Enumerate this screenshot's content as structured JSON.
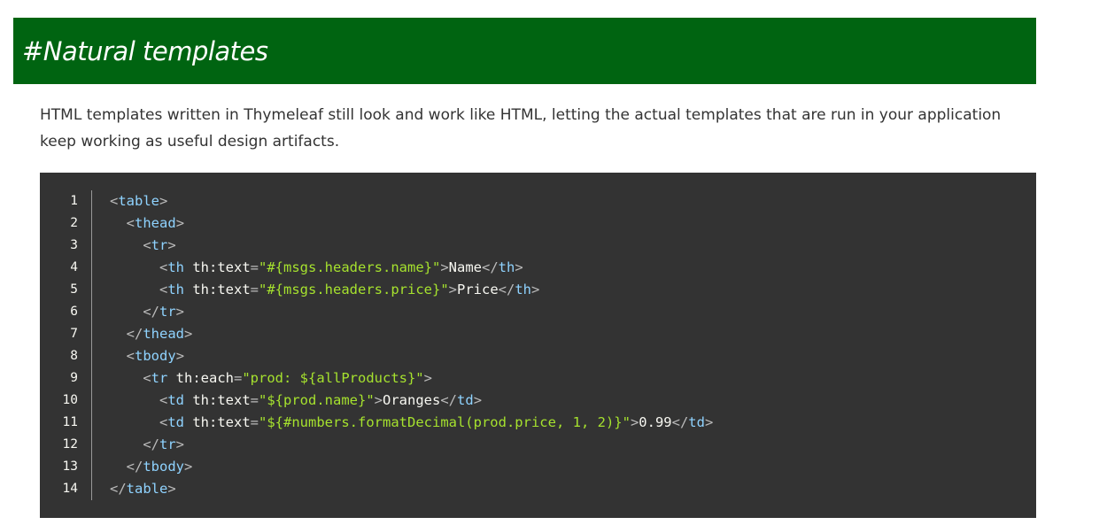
{
  "section": {
    "title": "#Natural templates",
    "description": "HTML templates written in Thymeleaf still look and work like HTML, letting the actual templates that are run in your application keep working as useful design artifacts."
  },
  "colors": {
    "heading_background": "#006411",
    "code_background": "#333333",
    "tag": "#8fd3ff",
    "string": "#a6e22e",
    "punctuation": "#bbbbbb",
    "text": "#f8f8f2"
  },
  "code": {
    "language": "html",
    "lines": [
      {
        "number": "1",
        "tokens": [
          {
            "t": "<",
            "k": "punct"
          },
          {
            "t": "table",
            "k": "tag"
          },
          {
            "t": ">",
            "k": "punct"
          }
        ]
      },
      {
        "number": "2",
        "tokens": [
          {
            "t": "  ",
            "k": "text"
          },
          {
            "t": "<",
            "k": "punct"
          },
          {
            "t": "thead",
            "k": "tag"
          },
          {
            "t": ">",
            "k": "punct"
          }
        ]
      },
      {
        "number": "3",
        "tokens": [
          {
            "t": "    ",
            "k": "text"
          },
          {
            "t": "<",
            "k": "punct"
          },
          {
            "t": "tr",
            "k": "tag"
          },
          {
            "t": ">",
            "k": "punct"
          }
        ]
      },
      {
        "number": "4",
        "tokens": [
          {
            "t": "      ",
            "k": "text"
          },
          {
            "t": "<",
            "k": "punct"
          },
          {
            "t": "th",
            "k": "tag"
          },
          {
            "t": " th:text",
            "k": "attr"
          },
          {
            "t": "=",
            "k": "punct"
          },
          {
            "t": "\"#{msgs.headers.name}\"",
            "k": "str"
          },
          {
            "t": ">",
            "k": "punct"
          },
          {
            "t": "Name",
            "k": "text"
          },
          {
            "t": "</",
            "k": "punct"
          },
          {
            "t": "th",
            "k": "tag"
          },
          {
            "t": ">",
            "k": "punct"
          }
        ]
      },
      {
        "number": "5",
        "tokens": [
          {
            "t": "      ",
            "k": "text"
          },
          {
            "t": "<",
            "k": "punct"
          },
          {
            "t": "th",
            "k": "tag"
          },
          {
            "t": " th:text",
            "k": "attr"
          },
          {
            "t": "=",
            "k": "punct"
          },
          {
            "t": "\"#{msgs.headers.price}\"",
            "k": "str"
          },
          {
            "t": ">",
            "k": "punct"
          },
          {
            "t": "Price",
            "k": "text"
          },
          {
            "t": "</",
            "k": "punct"
          },
          {
            "t": "th",
            "k": "tag"
          },
          {
            "t": ">",
            "k": "punct"
          }
        ]
      },
      {
        "number": "6",
        "tokens": [
          {
            "t": "    ",
            "k": "text"
          },
          {
            "t": "</",
            "k": "punct"
          },
          {
            "t": "tr",
            "k": "tag"
          },
          {
            "t": ">",
            "k": "punct"
          }
        ]
      },
      {
        "number": "7",
        "tokens": [
          {
            "t": "  ",
            "k": "text"
          },
          {
            "t": "</",
            "k": "punct"
          },
          {
            "t": "thead",
            "k": "tag"
          },
          {
            "t": ">",
            "k": "punct"
          }
        ]
      },
      {
        "number": "8",
        "tokens": [
          {
            "t": "  ",
            "k": "text"
          },
          {
            "t": "<",
            "k": "punct"
          },
          {
            "t": "tbody",
            "k": "tag"
          },
          {
            "t": ">",
            "k": "punct"
          }
        ]
      },
      {
        "number": "9",
        "tokens": [
          {
            "t": "    ",
            "k": "text"
          },
          {
            "t": "<",
            "k": "punct"
          },
          {
            "t": "tr",
            "k": "tag"
          },
          {
            "t": " th:each",
            "k": "attr"
          },
          {
            "t": "=",
            "k": "punct"
          },
          {
            "t": "\"prod: ${allProducts}\"",
            "k": "str"
          },
          {
            "t": ">",
            "k": "punct"
          }
        ]
      },
      {
        "number": "10",
        "tokens": [
          {
            "t": "      ",
            "k": "text"
          },
          {
            "t": "<",
            "k": "punct"
          },
          {
            "t": "td",
            "k": "tag"
          },
          {
            "t": " th:text",
            "k": "attr"
          },
          {
            "t": "=",
            "k": "punct"
          },
          {
            "t": "\"${prod.name}\"",
            "k": "str"
          },
          {
            "t": ">",
            "k": "punct"
          },
          {
            "t": "Oranges",
            "k": "text"
          },
          {
            "t": "</",
            "k": "punct"
          },
          {
            "t": "td",
            "k": "tag"
          },
          {
            "t": ">",
            "k": "punct"
          }
        ]
      },
      {
        "number": "11",
        "tokens": [
          {
            "t": "      ",
            "k": "text"
          },
          {
            "t": "<",
            "k": "punct"
          },
          {
            "t": "td",
            "k": "tag"
          },
          {
            "t": " th:text",
            "k": "attr"
          },
          {
            "t": "=",
            "k": "punct"
          },
          {
            "t": "\"${#numbers.formatDecimal(prod.price, 1, 2)}\"",
            "k": "str"
          },
          {
            "t": ">",
            "k": "punct"
          },
          {
            "t": "0.99",
            "k": "text"
          },
          {
            "t": "</",
            "k": "punct"
          },
          {
            "t": "td",
            "k": "tag"
          },
          {
            "t": ">",
            "k": "punct"
          }
        ]
      },
      {
        "number": "12",
        "tokens": [
          {
            "t": "    ",
            "k": "text"
          },
          {
            "t": "</",
            "k": "punct"
          },
          {
            "t": "tr",
            "k": "tag"
          },
          {
            "t": ">",
            "k": "punct"
          }
        ]
      },
      {
        "number": "13",
        "tokens": [
          {
            "t": "  ",
            "k": "text"
          },
          {
            "t": "</",
            "k": "punct"
          },
          {
            "t": "tbody",
            "k": "tag"
          },
          {
            "t": ">",
            "k": "punct"
          }
        ]
      },
      {
        "number": "14",
        "tokens": [
          {
            "t": "</",
            "k": "punct"
          },
          {
            "t": "table",
            "k": "tag"
          },
          {
            "t": ">",
            "k": "punct"
          }
        ]
      }
    ]
  }
}
